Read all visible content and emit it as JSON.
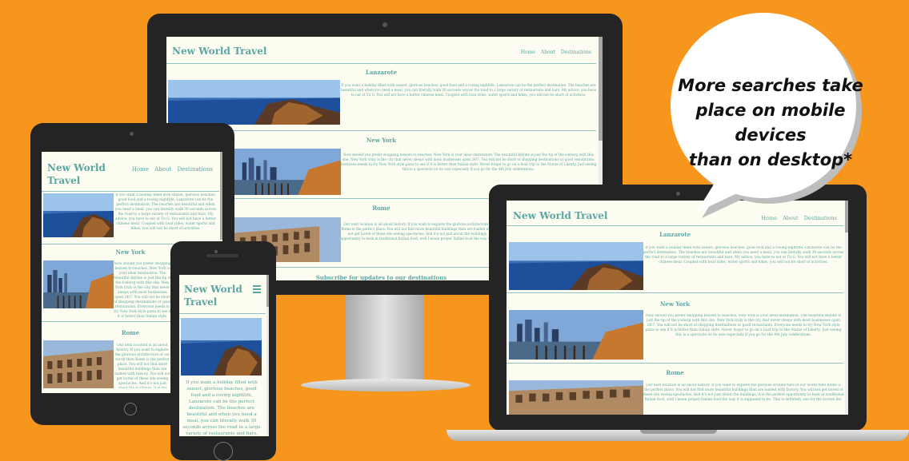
{
  "site": {
    "title": "New World Travel",
    "nav": [
      "Home",
      "About",
      "Destinations"
    ],
    "subscribe": "Subscribe for updates to our destinations"
  },
  "destinations": [
    {
      "name": "Lanzarote",
      "text": "If you want a holiday filled with sunset, glorious beaches, good food and a roving nightlife, Lanzarote can be the perfect destination. The beaches are beautiful and when you need a meal, you can literally walk 30 seconds across the road to a large variety of restaurants and bars. My advice, you have to eat at Tu G. You will not have a better chinese meal. Coupled with boat rides, water sports and hikes, you will not be short of activities."
    },
    {
      "name": "New York",
      "text": "Now should you prefer shopping heaven to beaches, New York is your ideal destination. The beautiful skyline is just the tip of the iceberg with this one. New York truly is the city that never sleeps with most businesses open 24/7. You will not be short of shopping destinations or good restaurants. Everyone needs to try New York style pizza to see if it is better than Italian style. Never forget to go on a boat trip to the Statue of Liberty. Just seeing this is a spectacle on its own especially if you go for the 4th July celebrations."
    },
    {
      "name": "Rome",
      "text": "Our next location is all about history. If you want to explore the glorious architecture of our world then Rome is the perfect place. You will not find more beautiful buildings than are loaded with history. You will not get bored of these site seeing spectacles. And it's not just about the buildings, it is the perfect opportunity to bask in traditional Italian food, well I mean proper Italian food the way it is supposed to be. This is definitely one for the bucket list."
    }
  ],
  "mobile_text": "If you want a holiday filled with sunset, glorious beaches, good food and a roving nightlife, Lanzarote can be the perfect destination. The beaches are beautiful and when you need a meal, you can literally walk 30 seconds across the road to a large variety of restaurants and bars.",
  "callout": {
    "line1": "More searches take",
    "line2": "place on mobile devices",
    "line3": "than on desktop*"
  },
  "colors": {
    "background": "#f7961c",
    "device": "#242424",
    "site_bg": "#fdfcf0",
    "accent_teal": "#5aa6a4"
  },
  "icons": [
    "hamburger-menu-icon",
    "camera-icon",
    "home-button-icon"
  ]
}
